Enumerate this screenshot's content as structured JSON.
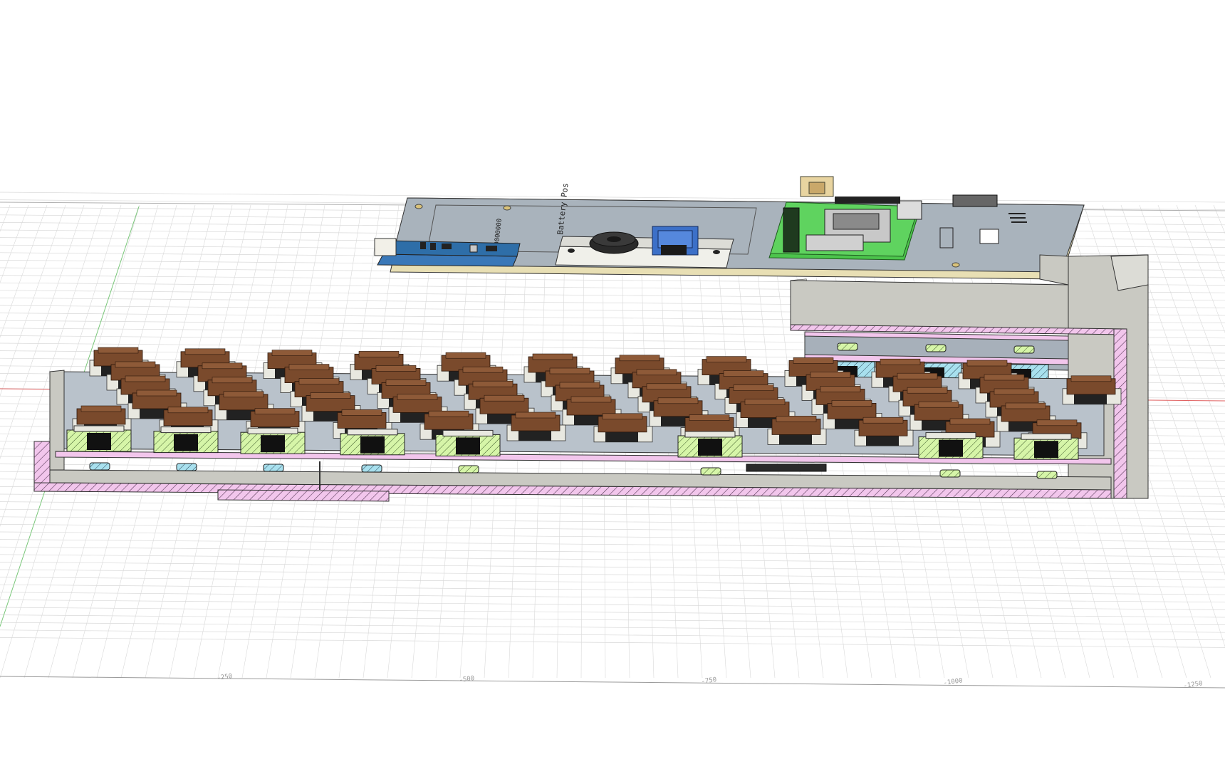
{
  "scene": {
    "description_labels": {
      "pcb_silkscreen_1": "Battery Pos",
      "pcb_silkscreen_2": "0000000"
    },
    "axis_tick_labels": [
      "-250",
      "-500",
      "-750",
      "-1000",
      "-1250"
    ],
    "colors": {
      "background": "#ffffff",
      "grid_line": "#d9d9d9",
      "axis_red": "#e06060",
      "axis_green": "#7ac77a",
      "pcb_gray": "#a9b3bc",
      "pcb_edge": "#e8dfb4",
      "keycap_brown": "#7a4a2c",
      "keycap_brown_top": "#8e5a38",
      "switch_white": "#e8e8e0",
      "section_pink": "#f2c6ec",
      "hatch_green": "#d6f5a8",
      "hatch_blue": "#a8e0ee",
      "case_gray": "#c9c9c2",
      "case_light": "#dcdcd6",
      "board_green": "#4cc44c",
      "board_blue": "#3a78b8",
      "knob_black": "#2a2a2a"
    }
  }
}
